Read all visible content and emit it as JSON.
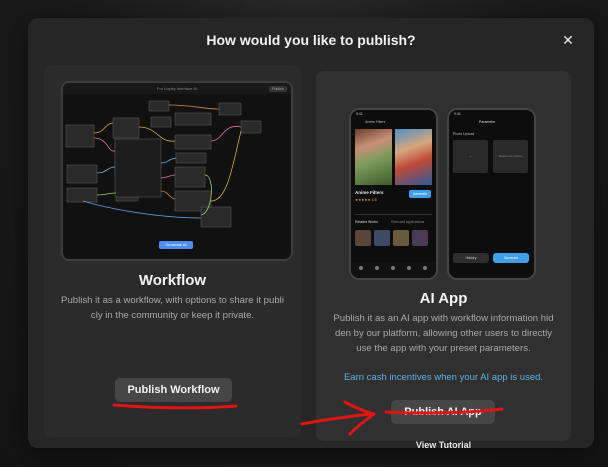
{
  "modal": {
    "title": "How would you like to publish?",
    "close_icon": "close-icon"
  },
  "workflow": {
    "heading": "Workflow",
    "description_lines": [
      "Publish it as a workflow, with options to share it publi",
      "cly in the community or keep it private."
    ],
    "button_label": "Publish Workflow",
    "preview": {
      "top_title": "For Liquity Interface AI",
      "top_button": "Publish",
      "cta": "Generate AI"
    }
  },
  "ai_app": {
    "heading": "AI App",
    "description_lines": [
      "Publish it as an AI app with workflow information hid",
      "den by our platform, allowing other users to directly",
      "use the app with your preset parameters."
    ],
    "earn_text": "Earn cash incentives when your AI app is used.",
    "button_label": "Publish AI App",
    "tutorial_label": "View Tutorial",
    "phone1": {
      "status": "9:41",
      "header": "Anime Filters",
      "title": "Anime Filters",
      "rating": "★★★★★ 4.8",
      "action": "Generate",
      "section_label": "Related Works",
      "section_label_2": "Relevant applications"
    },
    "phone2": {
      "status": "9:41",
      "header": "Parameter",
      "upload_label": "Photo Upload",
      "tile_right": "Select one picture",
      "btn_left": "History",
      "btn_right": "Generate"
    }
  },
  "colors": {
    "accent_blue": "#3fa0ea",
    "link_blue": "#5ab2e6",
    "annotation_red": "#e01414"
  }
}
